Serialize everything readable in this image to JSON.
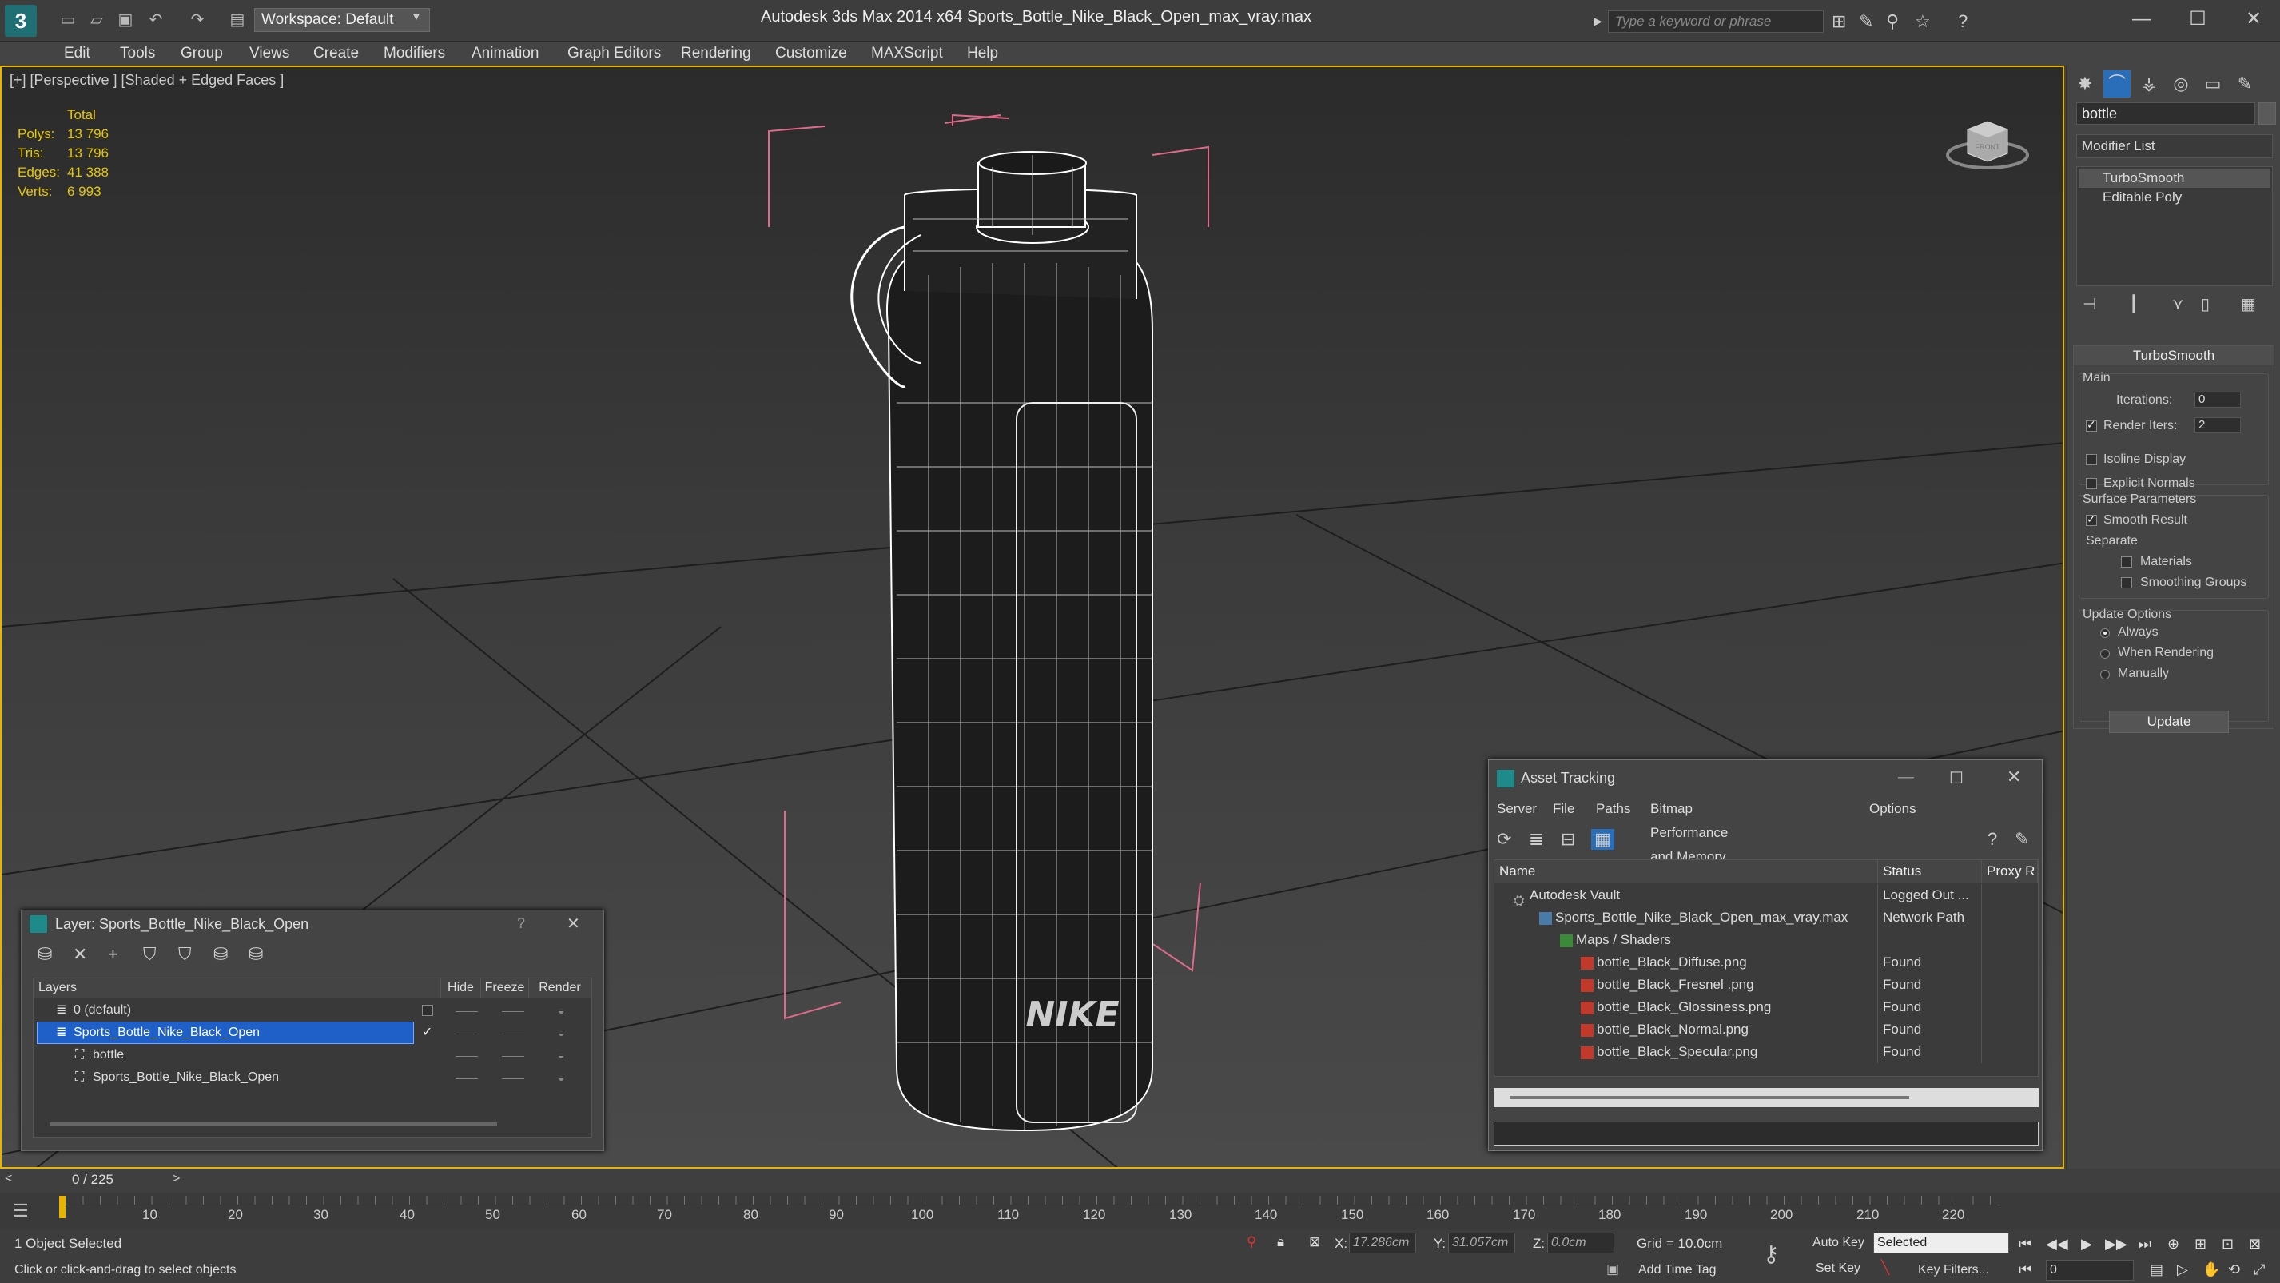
{
  "titlebar": {
    "workspace": "Workspace: Default",
    "app": "Autodesk 3ds Max  2014 x64",
    "file": "Sports_Bottle_Nike_Black_Open_max_vray.max",
    "search_placeholder": "Type a keyword or phrase"
  },
  "menu": [
    "Edit",
    "Tools",
    "Group",
    "Views",
    "Create",
    "Modifiers",
    "Animation",
    "Graph Editors",
    "Rendering",
    "Customize",
    "MAXScript",
    "Help"
  ],
  "viewport": {
    "label": "[+] [Perspective ] [Shaded + Edged Faces ]",
    "stats": {
      "header": "Total",
      "rows": [
        [
          "Polys:",
          "13 796"
        ],
        [
          "Tris:",
          "13 796"
        ],
        [
          "Edges:",
          "41 388"
        ],
        [
          "Verts:",
          "6 993"
        ]
      ]
    },
    "logo_text": "NIKE",
    "viewcube_text": "FRONT"
  },
  "command_panel": {
    "object_name": "bottle",
    "modifier_list": "Modifier List",
    "stack": [
      "TurboSmooth",
      "Editable Poly"
    ],
    "rollout": {
      "title": "TurboSmooth",
      "main": "Main",
      "iterations_label": "Iterations:",
      "iterations": "0",
      "render_iters_label": "Render Iters:",
      "render_iters": "2",
      "isoline": "Isoline Display",
      "explicit": "Explicit Normals",
      "surface": "Surface Parameters",
      "smooth_result": "Smooth Result",
      "separate": "Separate",
      "materials": "Materials",
      "smoothing_groups": "Smoothing Groups",
      "update_options": "Update Options",
      "always": "Always",
      "when_rendering": "When Rendering",
      "manually": "Manually",
      "update": "Update"
    }
  },
  "layer_dialog": {
    "title": "Layer: Sports_Bottle_Nike_Black_Open",
    "help": "?",
    "headers": [
      "Layers",
      "Hide",
      "Freeze",
      "Render"
    ],
    "rows": [
      "0 (default)",
      "Sports_Bottle_Nike_Black_Open",
      "bottle",
      "Sports_Bottle_Nike_Black_Open"
    ]
  },
  "asset_dialog": {
    "title": "Asset Tracking",
    "menu": [
      "Server",
      "File",
      "Paths",
      "Bitmap Performance and Memory",
      "Options"
    ],
    "headers": [
      "Name",
      "Status",
      "Proxy R"
    ],
    "rows": [
      {
        "name": "Autodesk Vault",
        "status": "Logged Out ..."
      },
      {
        "name": "Sports_Bottle_Nike_Black_Open_max_vray.max",
        "status": "Network Path"
      },
      {
        "name": "Maps / Shaders",
        "status": ""
      },
      {
        "name": "bottle_Black_Diffuse.png",
        "status": "Found"
      },
      {
        "name": "bottle_Black_Fresnel .png",
        "status": "Found"
      },
      {
        "name": "bottle_Black_Glossiness.png",
        "status": "Found"
      },
      {
        "name": "bottle_Black_Normal.png",
        "status": "Found"
      },
      {
        "name": "bottle_Black_Specular.png",
        "status": "Found"
      }
    ]
  },
  "timeline": {
    "frame": "0 / 225",
    "ticks": [
      "10",
      "20",
      "30",
      "40",
      "50",
      "60",
      "70",
      "80",
      "90",
      "100",
      "110",
      "120",
      "130",
      "140",
      "150",
      "160",
      "170",
      "180",
      "190",
      "200",
      "210",
      "220"
    ]
  },
  "status": {
    "selected": "1 Object Selected",
    "hint": "Click or click-and-drag to select objects",
    "x_label": "X:",
    "x": "17.286cm",
    "y_label": "Y:",
    "y": "31.057cm",
    "z_label": "Z:",
    "z": "0.0cm",
    "grid": "Grid = 10.0cm",
    "add_time_tag": "Add Time Tag",
    "auto_key": "Auto Key",
    "set_key": "Set Key",
    "key_mode": "Selected",
    "key_filters": "Key Filters...",
    "frame": "0"
  }
}
